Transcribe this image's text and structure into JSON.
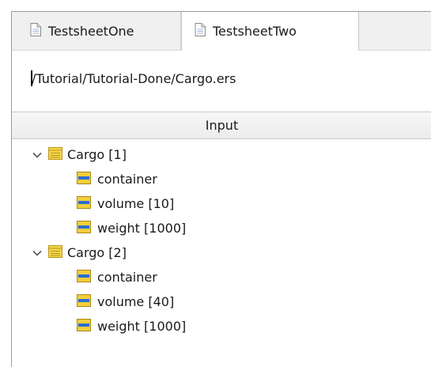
{
  "tabs": [
    {
      "label": "TestsheetOne",
      "icon": "document-icon",
      "active": false
    },
    {
      "label": "TestsheetTwo",
      "icon": "document-icon",
      "active": true
    }
  ],
  "path": "/Tutorial/Tutorial-Done/Cargo.ers",
  "column_header": "Input",
  "tree": [
    {
      "label": "Cargo [1]",
      "expanded": true,
      "children": [
        {
          "label": "container"
        },
        {
          "label": "volume [10]"
        },
        {
          "label": "weight [1000]"
        }
      ]
    },
    {
      "label": "Cargo [2]",
      "expanded": true,
      "children": [
        {
          "label": "container"
        },
        {
          "label": "volume [40]"
        },
        {
          "label": "weight [1000]"
        }
      ]
    }
  ],
  "colors": {
    "entity_icon_fill": "#f5d54a",
    "attribute_icon_fill": "#f2cf3a",
    "attribute_icon_bar": "#2a6fd6"
  }
}
